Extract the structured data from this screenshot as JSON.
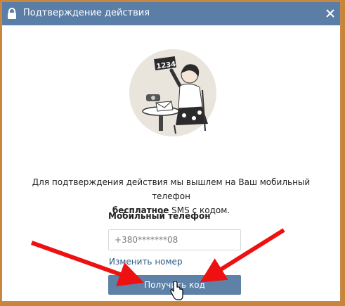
{
  "dialog": {
    "title": "Подтверждение действия",
    "message_part1": "Для подтверждения действия мы вышлем на Ваш мобильный телефон",
    "message_bold": "бесплатное",
    "message_part2": " SMS с кодом.",
    "phone_label": "Мобильный телефон",
    "phone_value": "+380*******08",
    "change_number": "Изменить номер",
    "get_code_button": "Получить код",
    "illustration_number": "1234"
  },
  "colors": {
    "titlebar": "#5b7ea6",
    "button": "#5e81a8",
    "link": "#2a5885",
    "arrows": "#ee1111",
    "frame": "#c58a4b"
  },
  "icons": [
    "lock-icon",
    "close-icon",
    "hand-cursor-icon"
  ]
}
